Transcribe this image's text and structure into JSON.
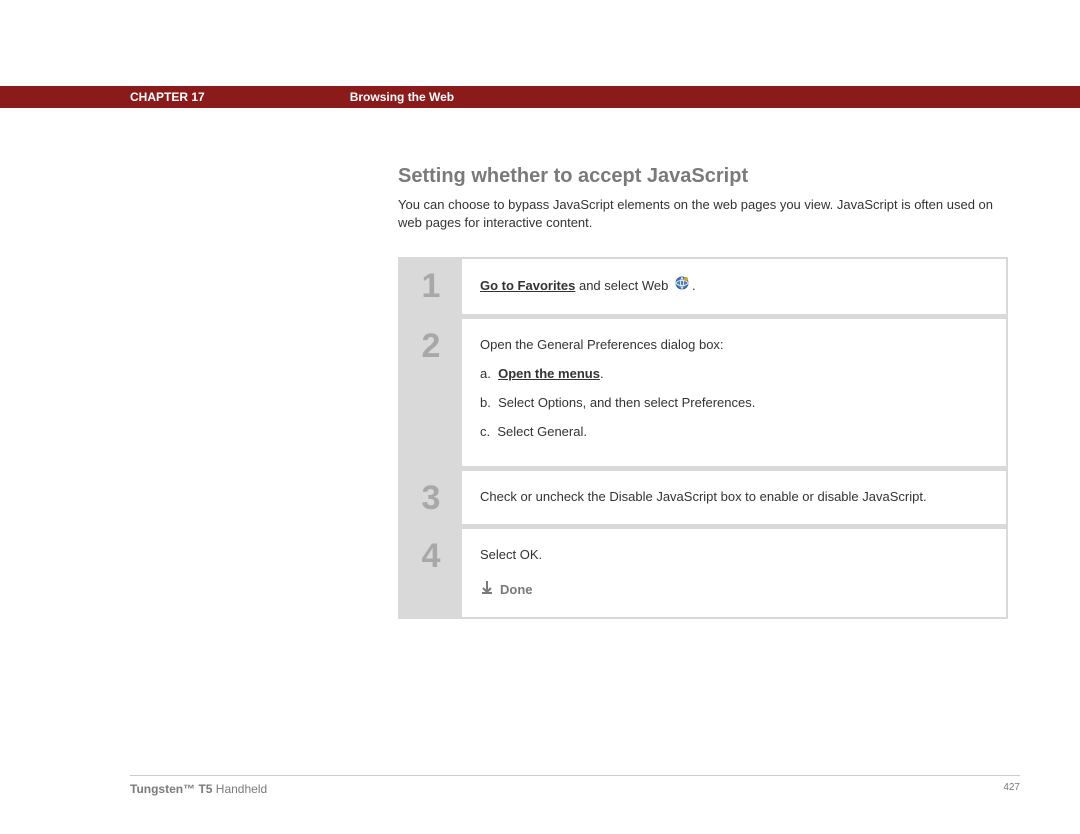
{
  "header": {
    "chapter": "CHAPTER 17",
    "title": "Browsing the Web"
  },
  "section": {
    "title": "Setting whether to accept JavaScript",
    "intro": "You can choose to bypass JavaScript elements on the web pages you view. JavaScript is often used on web pages for interactive content."
  },
  "steps": [
    {
      "num": "1",
      "link": "Go to Favorites",
      "after_link": " and select Web ",
      "icon": "web-icon",
      "trailing": "."
    },
    {
      "num": "2",
      "lead": "Open the General Preferences dialog box:",
      "subs": [
        {
          "label": "a.",
          "bold": "Open the menus",
          "after": "."
        },
        {
          "label": "b.",
          "text": "Select Options, and then select Preferences."
        },
        {
          "label": "c.",
          "text": "Select General."
        }
      ]
    },
    {
      "num": "3",
      "text": "Check or uncheck the Disable JavaScript box to enable or disable JavaScript."
    },
    {
      "num": "4",
      "text": "Select OK.",
      "done": "Done"
    }
  ],
  "footer": {
    "product_bold": "Tungsten™ T5",
    "product_rest": " Handheld",
    "page": "427"
  }
}
